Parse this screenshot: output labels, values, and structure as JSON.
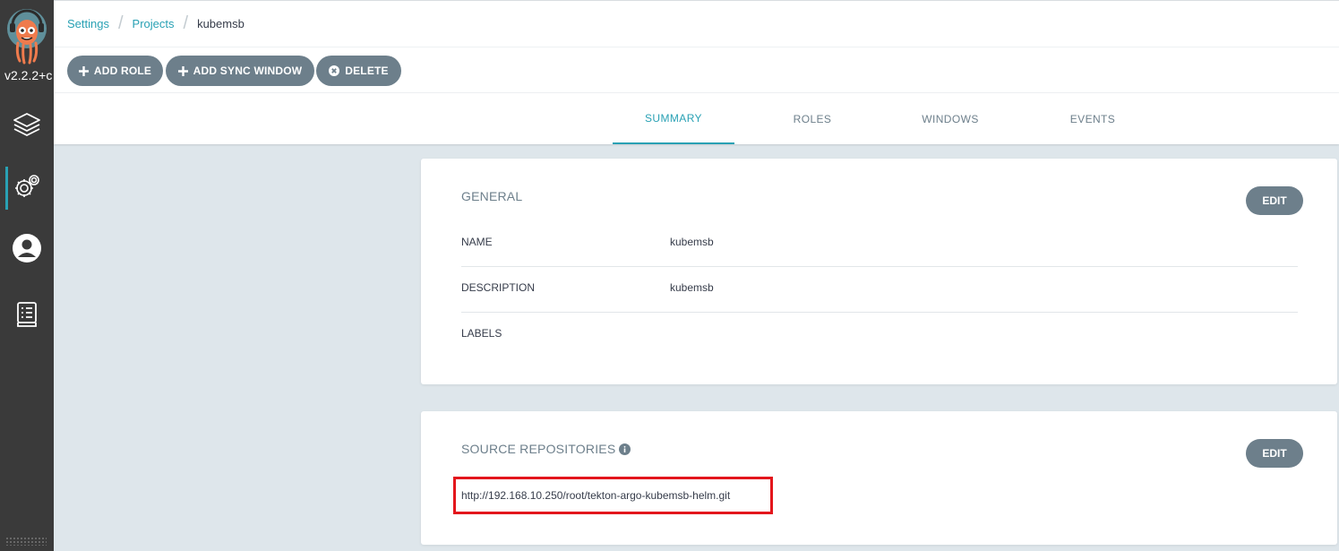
{
  "sidebar": {
    "version": "v2.2.2+c",
    "items": [
      {
        "name": "applications",
        "icon": "layers-icon",
        "active": false
      },
      {
        "name": "settings",
        "icon": "gears-icon",
        "active": true
      },
      {
        "name": "user-info",
        "icon": "user-circle-icon",
        "active": false
      },
      {
        "name": "documentation",
        "icon": "book-icon",
        "active": false
      }
    ]
  },
  "breadcrumb": [
    "Settings",
    "Projects",
    "kubemsb"
  ],
  "toolbar": {
    "add_role": "ADD ROLE",
    "add_sync_window": "ADD SYNC WINDOW",
    "delete": "DELETE"
  },
  "tabs": [
    "SUMMARY",
    "ROLES",
    "WINDOWS",
    "EVENTS"
  ],
  "active_tab": "SUMMARY",
  "general": {
    "title": "GENERAL",
    "edit": "EDIT",
    "fields": [
      {
        "label": "NAME",
        "value": "kubemsb"
      },
      {
        "label": "DESCRIPTION",
        "value": "kubemsb"
      },
      {
        "label": "LABELS",
        "value": ""
      }
    ]
  },
  "source_repos": {
    "title": "SOURCE REPOSITORIES",
    "edit": "EDIT",
    "repos": [
      "http://192.168.10.250/root/tekton-argo-kubemsb-helm.git"
    ]
  },
  "colors": {
    "accent": "#29a1b4",
    "button": "#6d7f8b",
    "sidebar": "#3a3a3a",
    "background": "#dee6eb",
    "highlight": "#e3161c"
  }
}
